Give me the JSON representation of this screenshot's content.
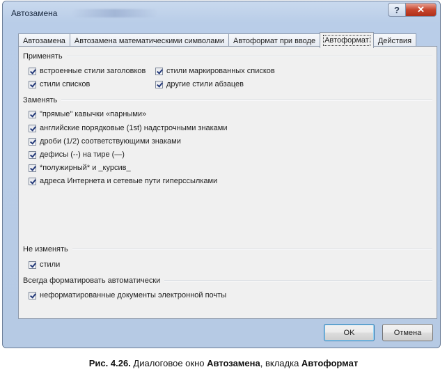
{
  "window": {
    "title": "Автозамена",
    "help_button": "?",
    "close_button": "✕"
  },
  "tabs": [
    {
      "label": "Автозамена"
    },
    {
      "label": "Автозамена математическими символами"
    },
    {
      "label": "Автоформат при вводе"
    },
    {
      "label": "Автоформат",
      "active": true
    },
    {
      "label": "Действия"
    }
  ],
  "sections": {
    "apply": {
      "label": "Применять",
      "options": [
        {
          "label": "встроенные стили заголовков",
          "checked": true
        },
        {
          "label": "стили маркированных списков",
          "checked": true
        },
        {
          "label": "стили списков",
          "checked": true
        },
        {
          "label": "другие стили абзацев",
          "checked": true
        }
      ]
    },
    "replace": {
      "label": "Заменять",
      "options": [
        {
          "label": "\"прямые\" кавычки «парными»",
          "checked": true
        },
        {
          "label": "английские порядковые (1st) надстрочными знаками",
          "checked": true
        },
        {
          "label": "дроби (1/2) соответствующими знаками",
          "checked": true
        },
        {
          "label": "дефисы (--) на тире (—)",
          "checked": true
        },
        {
          "label": "*полужирный* и _курсив_",
          "checked": true
        },
        {
          "label": "адреса Интернета и сетевые пути гиперссылками",
          "checked": true
        }
      ]
    },
    "preserve": {
      "label": "Не изменять",
      "options": [
        {
          "label": "стили",
          "checked": true
        }
      ]
    },
    "always": {
      "label": "Всегда форматировать автоматически",
      "options": [
        {
          "label": "неформатированные документы электронной почты",
          "checked": true
        }
      ]
    }
  },
  "buttons": {
    "ok": "OK",
    "cancel": "Отмена"
  },
  "caption": {
    "figure": "Рис. 4.26.",
    "text1": " Диалоговое окно ",
    "bold1": "Автозамена",
    "text2": ", вкладка ",
    "bold2": "Автоформат"
  }
}
